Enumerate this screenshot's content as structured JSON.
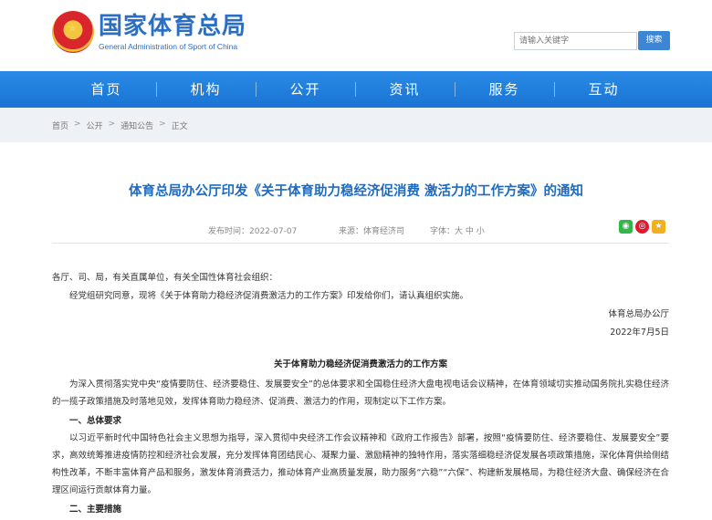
{
  "header": {
    "site_title": "国家体育总局",
    "site_subtitle": "General Administration of Sport of China",
    "search_placeholder": "请输入关键字",
    "search_button": "搜索"
  },
  "nav": {
    "items": [
      "首页",
      "机构",
      "公开",
      "资讯",
      "服务",
      "互动"
    ]
  },
  "breadcrumb": {
    "items": [
      "首页",
      "公开",
      "通知公告",
      "正文"
    ],
    "separator": ">"
  },
  "article": {
    "title": "体育总局办公厅印发《关于体育助力稳经济促消费 激活力的工作方案》的通知",
    "date": "发布时间：2022-07-07",
    "source": "来源：体育经济司",
    "font_size": "字体：大 中 小",
    "salutation": "各厅、司、局，有关直属单位，有关全国性体育社会组织：",
    "intro": "经党组研究同意，现将《关于体育助力稳经济促消费激活力的工作方案》印发给你们，请认真组织实施。",
    "signer": "体育总局办公厅",
    "sign_date": "2022年7月5日",
    "doc_title": "关于体育助力稳经济促消费激活力的工作方案",
    "para1": "为深入贯彻落实党中央“疫情要防住、经济要稳住、发展要安全”的总体要求和全国稳住经济大盘电视电话会议精神，在体育领域切实推动国务院扎实稳住经济的一揽子政策措施及时落地见效，发挥体育助力稳经济、促消费、激活力的作用，现制定以下工作方案。",
    "section1": "一、总体要求",
    "para2": "以习近平新时代中国特色社会主义思想为指导，深入贯彻中央经济工作会议精神和《政府工作报告》部署，按照“疫情要防住、经济要稳住、发展要安全”要求，高效统筹推进疫情防控和经济社会发展，充分发挥体育团结民心、凝聚力量、激励精神的独特作用，落实落细稳经济促发展各项政策措施，深化体育供给侧结构性改革，不断丰富体育产品和服务，激发体育消费活力，推动体育产业高质量发展，助力服务“六稳”“六保”、构建新发展格局，为稳住经济大盘、确保经济在合理区间运行贡献体育力量。",
    "section2": "二、主要措施"
  },
  "share": {
    "wechat_icon": "wechat-icon",
    "weibo_icon": "weibo-icon",
    "favorite_icon": "star-icon"
  }
}
